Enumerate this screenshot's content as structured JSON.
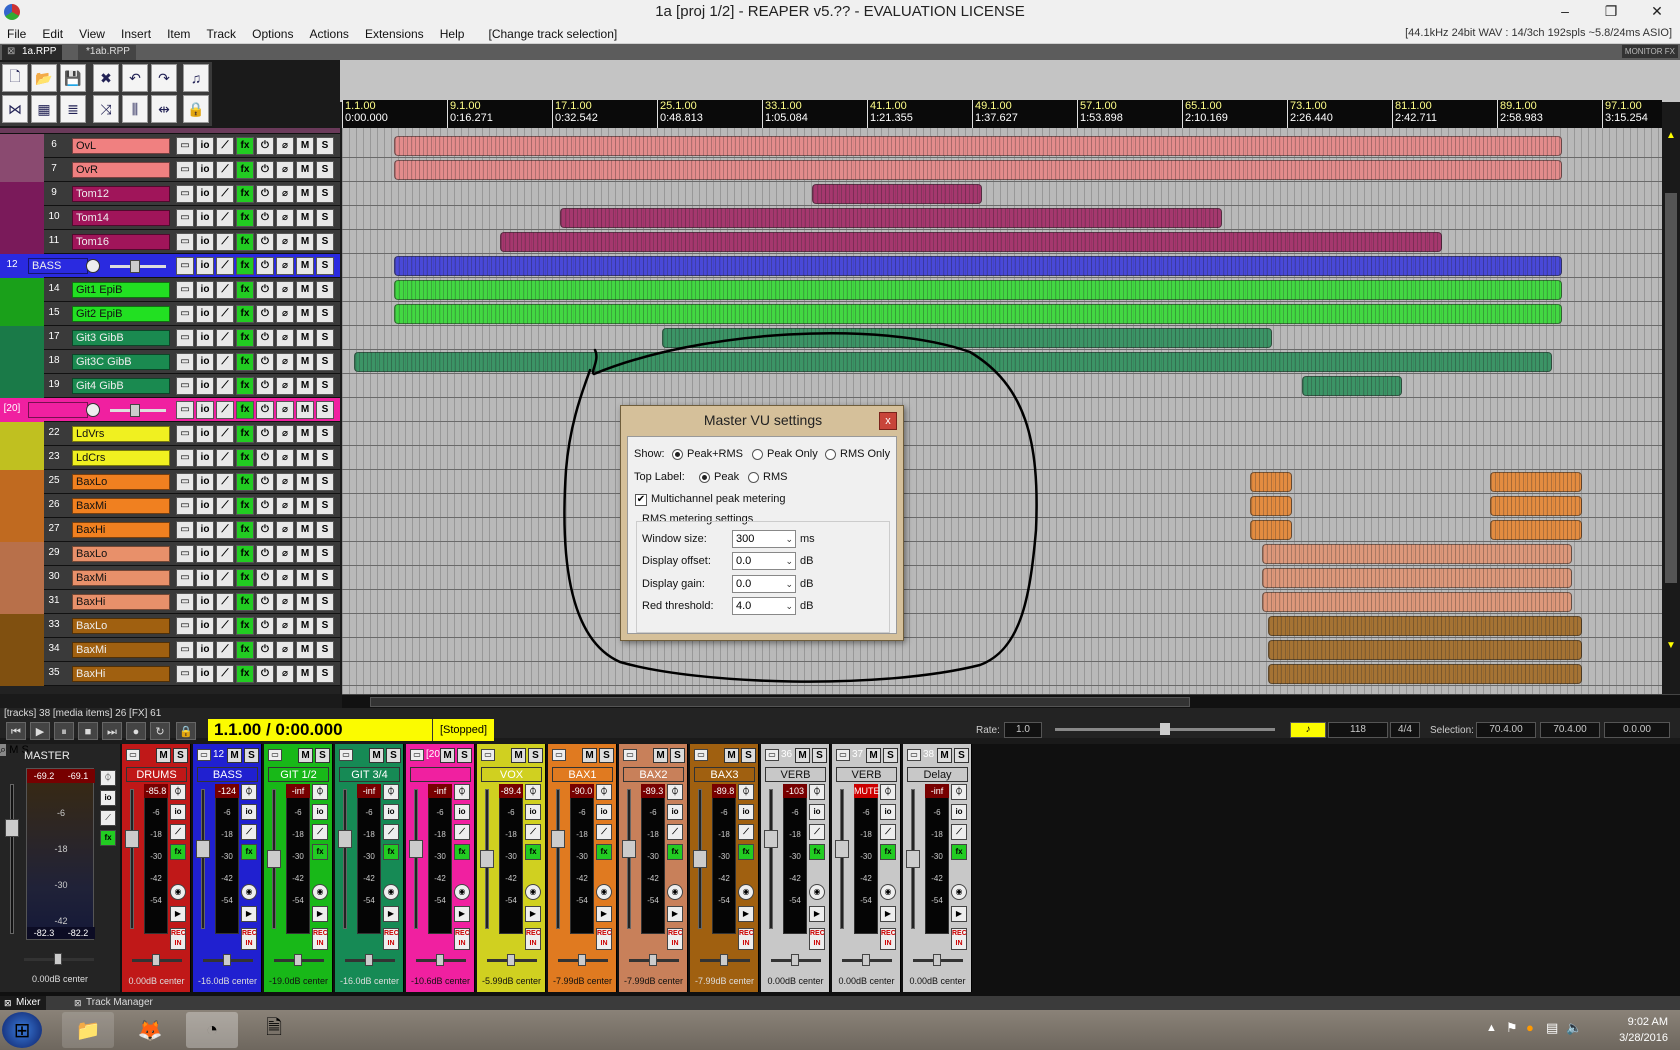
{
  "window": {
    "title": "1a [proj 1/2] - REAPER v5.?? - EVALUATION LICENSE",
    "minimize": "–",
    "maximize": "❐",
    "close": "✕"
  },
  "menu": [
    "File",
    "Edit",
    "View",
    "Insert",
    "Item",
    "Track",
    "Options",
    "Actions",
    "Extensions",
    "Help",
    "[Change track selection]"
  ],
  "audio_status": "[44.1kHz 24bit WAV : 14/3ch 192spls ~5.8/24ms ASIO]",
  "project_tabs": [
    {
      "label": "1a.RPP",
      "active": true
    },
    {
      "label": "*1ab.RPP",
      "active": false
    }
  ],
  "monitor_fx": "MONITOR FX",
  "ruler": [
    {
      "bar": "1.1.00",
      "time": "0:00.000"
    },
    {
      "bar": "9.1.00",
      "time": "0:16.271"
    },
    {
      "bar": "17.1.00",
      "time": "0:32.542"
    },
    {
      "bar": "25.1.00",
      "time": "0:48.813"
    },
    {
      "bar": "33.1.00",
      "time": "1:05.084"
    },
    {
      "bar": "41.1.00",
      "time": "1:21.355"
    },
    {
      "bar": "49.1.00",
      "time": "1:37.627"
    },
    {
      "bar": "57.1.00",
      "time": "1:53.898"
    },
    {
      "bar": "65.1.00",
      "time": "2:10.169"
    },
    {
      "bar": "73.1.00",
      "time": "2:26.440"
    },
    {
      "bar": "81.1.00",
      "time": "2:42.711"
    },
    {
      "bar": "89.1.00",
      "time": "2:58.983"
    },
    {
      "bar": "97.1.00",
      "time": "3:15.254"
    }
  ],
  "tracks": [
    {
      "num": "6",
      "name": "OvL",
      "color": "#f08080",
      "side": "#8a4a70"
    },
    {
      "num": "7",
      "name": "OvR",
      "color": "#f08080",
      "side": "#8a4a70"
    },
    {
      "num": "9",
      "name": "Tom12",
      "color": "#a0155a",
      "side": "#7a1a5a"
    },
    {
      "num": "10",
      "name": "Tom14",
      "color": "#a0155a",
      "side": "#7a1a5a"
    },
    {
      "num": "11",
      "name": "Tom16",
      "color": "#a0155a",
      "side": "#7a1a5a"
    },
    {
      "num": "12",
      "name": "BASS",
      "color": "#2a2ae0",
      "side": "#2a2ae0",
      "folder": true
    },
    {
      "num": "14",
      "name": "Git1 EpiB",
      "color": "#22e022",
      "side": "#1aa01a"
    },
    {
      "num": "15",
      "name": "Git2 EpiB",
      "color": "#22e022",
      "side": "#1aa01a"
    },
    {
      "num": "17",
      "name": "Git3 GibB",
      "color": "#1a8a50",
      "side": "#1a7a48"
    },
    {
      "num": "18",
      "name": "Git3C GibB",
      "color": "#1a8a50",
      "side": "#1a7a48"
    },
    {
      "num": "19",
      "name": "Git4 GibB",
      "color": "#1a8a50",
      "side": "#1a7a48"
    },
    {
      "num": "[20]",
      "name": "",
      "color": "#f020a0",
      "side": "#f020a0",
      "folder": true
    },
    {
      "num": "22",
      "name": "LdVrs",
      "color": "#f0f020",
      "side": "#c0c020"
    },
    {
      "num": "23",
      "name": "LdCrs",
      "color": "#f0f020",
      "side": "#c0c020"
    },
    {
      "num": "25",
      "name": "BaxLo",
      "color": "#f08020",
      "side": "#c06a20"
    },
    {
      "num": "26",
      "name": "BaxMi",
      "color": "#f08020",
      "side": "#c06a20"
    },
    {
      "num": "27",
      "name": "BaxHi",
      "color": "#f08020",
      "side": "#c06a20"
    },
    {
      "num": "29",
      "name": "BaxLo",
      "color": "#e8906a",
      "side": "#b8704a"
    },
    {
      "num": "30",
      "name": "BaxMi",
      "color": "#e8906a",
      "side": "#b8704a"
    },
    {
      "num": "31",
      "name": "BaxHi",
      "color": "#e8906a",
      "side": "#b8704a"
    },
    {
      "num": "33",
      "name": "BaxLo",
      "color": "#a06010",
      "side": "#805010"
    },
    {
      "num": "34",
      "name": "BaxMi",
      "color": "#a06010",
      "side": "#805010"
    },
    {
      "num": "35",
      "name": "BaxHi",
      "color": "#a06010",
      "side": "#805010"
    }
  ],
  "track_buttons": [
    "io",
    "fx",
    "M",
    "S"
  ],
  "status_line": "[tracks] 38 [media items] 26 [FX] 61",
  "transport": {
    "position": "1.1.00 / 0:00.000",
    "state": "[Stopped]",
    "rate_label": "Rate:",
    "rate": "1.0",
    "bpm": "118",
    "timesig": "4/4",
    "selection_label": "Selection:",
    "sel_start": "70.4.00",
    "sel_end": "70.4.00",
    "sel_len": "0.0.00"
  },
  "mixer": {
    "master": {
      "name": "MASTER",
      "peak_l": "-69.2",
      "peak_r": "-69.1",
      "rms_l": "-82.3",
      "rms_r": "-82.2",
      "vol": "0.00dB center"
    },
    "strips": [
      {
        "num": "",
        "name": "DRUMS",
        "color": "#c01818",
        "peak": "-85.8",
        "vol": "0.00dB center"
      },
      {
        "num": "12",
        "name": "BASS",
        "color": "#2020d0",
        "peak": "-124",
        "vol": "-16.0dB center"
      },
      {
        "num": "",
        "name": "GIT 1/2",
        "color": "#18b818",
        "peak": "-inf",
        "vol": "-19.0dB center"
      },
      {
        "num": "",
        "name": "GIT 3/4",
        "color": "#168a55",
        "peak": "-inf",
        "vol": "-16.0dB center"
      },
      {
        "num": "[20]",
        "name": "",
        "color": "#f020a0",
        "peak": "-inf",
        "vol": "-10.6dB center"
      },
      {
        "num": "",
        "name": "VOX",
        "color": "#d0d020",
        "peak": "-89.4",
        "vol": "-5.99dB center"
      },
      {
        "num": "",
        "name": "BAX1",
        "color": "#e07a20",
        "peak": "-90.0",
        "vol": "-7.99dB center"
      },
      {
        "num": "",
        "name": "BAX2",
        "color": "#c8805a",
        "peak": "-89.3",
        "vol": "-7.99dB center"
      },
      {
        "num": "",
        "name": "BAX3",
        "color": "#a06010",
        "peak": "-89.8",
        "vol": "-7.99dB center"
      },
      {
        "num": "36",
        "name": "VERB",
        "color": "#c8c8c8",
        "peak": "-103",
        "vol": "0.00dB center"
      },
      {
        "num": "37",
        "name": "VERB",
        "color": "#c8c8c8",
        "peak": "MUTE",
        "vol": "0.00dB center"
      },
      {
        "num": "38",
        "name": "Delay",
        "color": "#c8c8c8",
        "peak": "-inf",
        "vol": "0.00dB center"
      }
    ],
    "meter_ticks": [
      "-6",
      "-18",
      "-30",
      "-42",
      "-54"
    ],
    "rec_in": "REC IN"
  },
  "docker_tabs": [
    {
      "label": "Mixer",
      "active": true
    },
    {
      "label": "Track Manager",
      "active": false
    }
  ],
  "dialog": {
    "title": "Master VU settings",
    "close": "x",
    "show_label": "Show:",
    "show_options": [
      "Peak+RMS",
      "Peak Only",
      "RMS Only"
    ],
    "show_selected": 0,
    "top_label": "Top Label:",
    "top_options": [
      "Peak",
      "RMS"
    ],
    "top_selected": 0,
    "multichannel_label": "Multichannel peak metering",
    "multichannel_checked": true,
    "group_title": "RMS metering settings",
    "fields": [
      {
        "label": "Window size:",
        "value": "300",
        "unit": "ms"
      },
      {
        "label": "Display offset:",
        "value": "0.0",
        "unit": "dB"
      },
      {
        "label": "Display gain:",
        "value": "0.0",
        "unit": "dB"
      },
      {
        "label": "Red threshold:",
        "value": "4.0",
        "unit": "dB"
      }
    ]
  },
  "taskbar": {
    "time": "9:02 AM",
    "date": "3/28/2016"
  }
}
